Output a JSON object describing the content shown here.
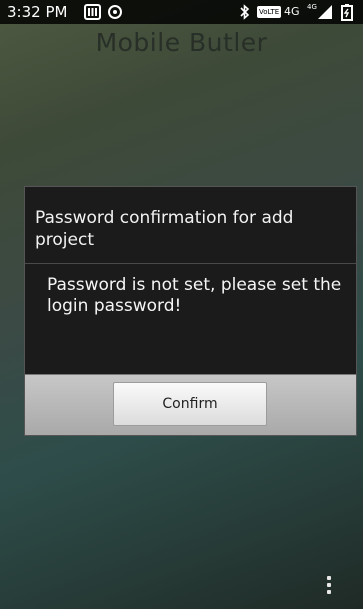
{
  "status_bar": {
    "time": "3:32 PM",
    "network": "4G",
    "volte": "VoLTE",
    "small_network": "4G"
  },
  "app": {
    "title": "Mobile Butler"
  },
  "dialog": {
    "title": "Password confirmation for add project",
    "message": "Password is not set, please set the login password!",
    "confirm_label": "Confirm"
  },
  "icons": [
    "notification-icon",
    "sync-icon",
    "bluetooth-icon",
    "signal-icon",
    "battery-icon",
    "overflow-menu-icon"
  ]
}
